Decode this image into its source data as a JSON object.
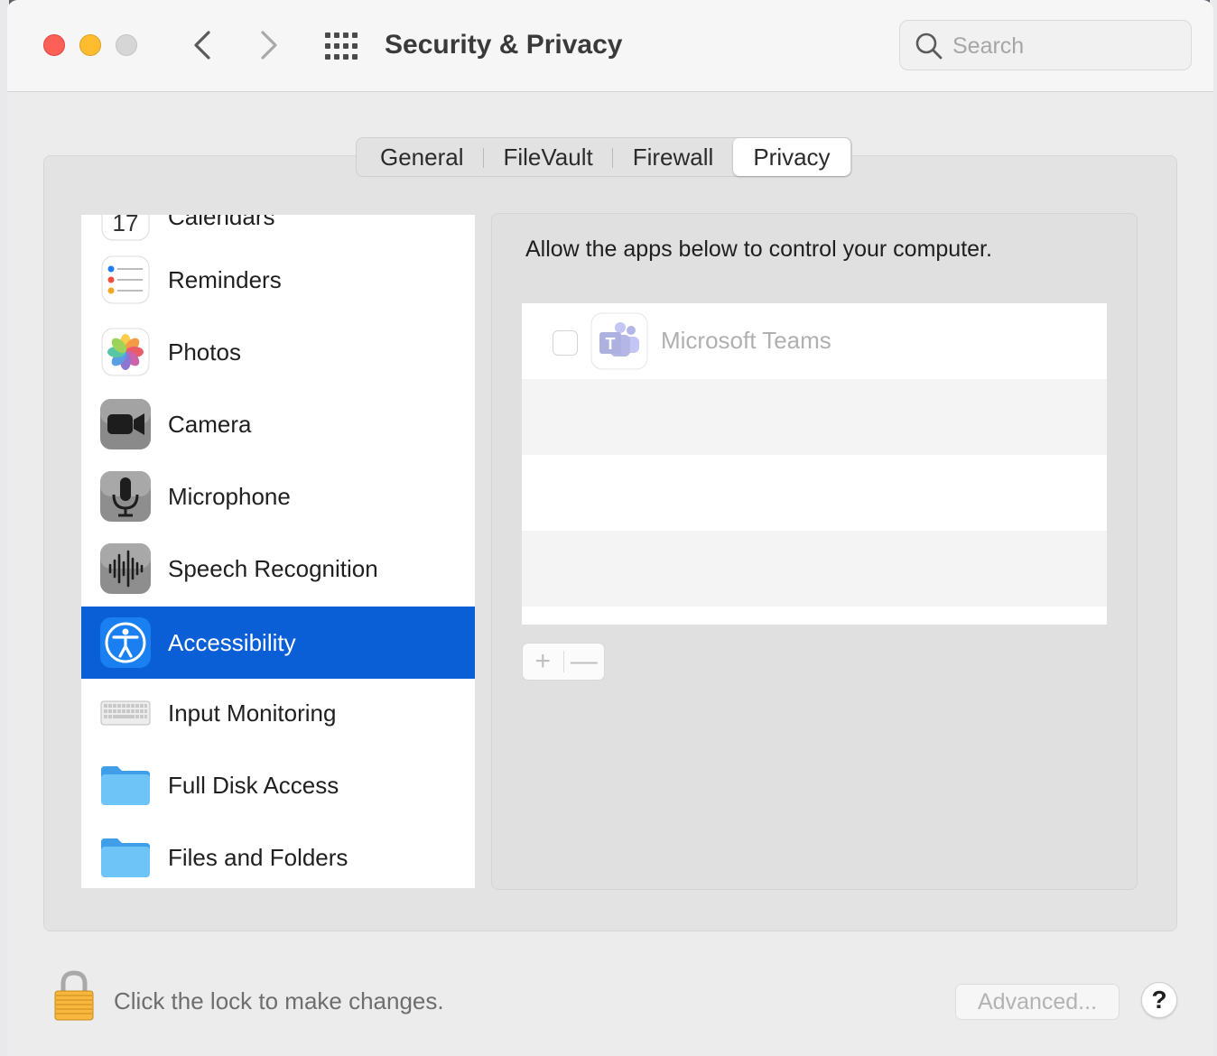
{
  "window": {
    "title": "Security & Privacy"
  },
  "search": {
    "placeholder": "Search"
  },
  "tabs": [
    {
      "label": "General"
    },
    {
      "label": "FileVault"
    },
    {
      "label": "Firewall"
    },
    {
      "label": "Privacy"
    }
  ],
  "active_tab": "Privacy",
  "sidebar": {
    "items": [
      {
        "label": "Calendars",
        "icon": "calendar-icon"
      },
      {
        "label": "Reminders",
        "icon": "reminders-icon"
      },
      {
        "label": "Photos",
        "icon": "photos-icon"
      },
      {
        "label": "Camera",
        "icon": "camera-icon"
      },
      {
        "label": "Microphone",
        "icon": "microphone-icon"
      },
      {
        "label": "Speech Recognition",
        "icon": "waveform-icon"
      },
      {
        "label": "Accessibility",
        "icon": "accessibility-icon"
      },
      {
        "label": "Input Monitoring",
        "icon": "keyboard-icon"
      },
      {
        "label": "Full Disk Access",
        "icon": "folder-icon"
      },
      {
        "label": "Files and Folders",
        "icon": "folder-icon"
      }
    ],
    "selected": "Accessibility"
  },
  "detail": {
    "instruction": "Allow the apps below to control your computer.",
    "apps": [
      {
        "name": "Microsoft Teams",
        "checked": false,
        "icon": "teams-icon"
      }
    ],
    "add_label": "+",
    "remove_label": "—"
  },
  "footer": {
    "lock_text": "Click the lock to make changes.",
    "advanced_label": "Advanced...",
    "help_label": "?"
  },
  "colors": {
    "selection": "#0a5fd6",
    "close": "#fe5f57",
    "minimize": "#febc2e"
  }
}
